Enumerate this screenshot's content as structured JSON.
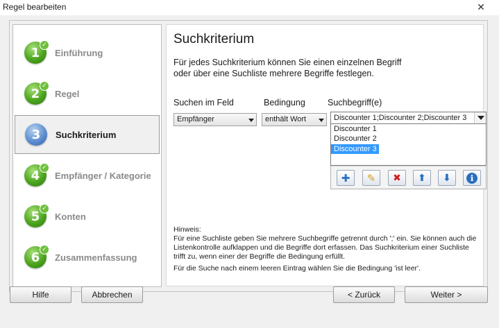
{
  "window": {
    "title": "Regel bearbeiten",
    "close_glyph": "✕"
  },
  "steps": [
    {
      "number": "1",
      "label": "Einführung",
      "state": "done",
      "icon": "green-circle-1-icon"
    },
    {
      "number": "2",
      "label": "Regel",
      "state": "done",
      "icon": "green-circle-2-icon"
    },
    {
      "number": "3",
      "label": "Suchkriterium",
      "state": "current",
      "icon": "blue-circle-3-icon"
    },
    {
      "number": "4",
      "label": "Empfänger / Kategorie",
      "state": "done",
      "icon": "green-circle-4-icon"
    },
    {
      "number": "5",
      "label": "Konten",
      "state": "done",
      "icon": "green-circle-5-icon"
    },
    {
      "number": "6",
      "label": "Zusammenfassung",
      "state": "done",
      "icon": "green-circle-6-icon"
    }
  ],
  "main": {
    "heading": "Suchkriterium",
    "description_line1": "Für jedes Suchkriterium können Sie einen einzelnen Begriff",
    "description_line2": "oder über eine Suchliste mehrere Begriffe festlegen.",
    "field_label": "Suchen im Feld",
    "field_value": "Empfänger",
    "condition_label": "Bedingung",
    "condition_value": "enthält Wort",
    "terms_label": "Suchbegriff(e)",
    "terms_value": "Discounter 1;Discounter 2;Discounter 3",
    "terms_list": [
      "Discounter 1",
      "Discounter 2",
      "Discounter 3"
    ],
    "selected_term_index": 2,
    "toolbar": [
      {
        "name": "add-icon",
        "glyph": "✚",
        "color": "#2a6fc0"
      },
      {
        "name": "edit-icon",
        "glyph": "✎",
        "color": "#d4a017"
      },
      {
        "name": "delete-icon",
        "glyph": "✖",
        "color": "#d02020"
      },
      {
        "name": "move-up-icon",
        "glyph": "⬆",
        "color": "#2a6fc0"
      },
      {
        "name": "move-down-icon",
        "glyph": "⬇",
        "color": "#2a6fc0"
      },
      {
        "name": "info-icon",
        "glyph": "ℹ",
        "color": "#2a6fc0"
      }
    ],
    "hint_title": "Hinweis:",
    "hint_text": "Für eine Suchliste geben Sie mehrere Suchbegriffe getrennt durch ';' ein. Sie können auch die Listenkontrolle aufklappen und die Begriffe dort erfassen. Das Suchkriterium einer Suchliste trifft zu, wenn einer der Begriffe die Bedingung erfüllt.",
    "hint_empty": "Für die Suche nach einem leeren Eintrag wählen Sie die Bedingung 'ist leer'."
  },
  "buttons": {
    "help": "Hilfe",
    "cancel": "Abbrechen",
    "back": "< Zurück",
    "next": "Weiter >"
  }
}
